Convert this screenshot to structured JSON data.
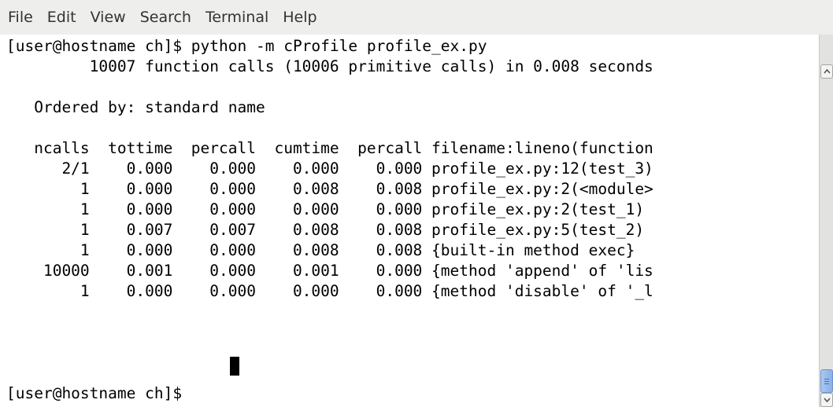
{
  "menu": {
    "items": [
      "File",
      "Edit",
      "View",
      "Search",
      "Terminal",
      "Help"
    ]
  },
  "terminal": {
    "prompt_command": "[user@hostname ch]$ python -m cProfile profile_ex.py",
    "summary": "         10007 function calls (10006 primitive calls) in 0.008 seconds",
    "ordered_by": "   Ordered by: standard name",
    "table_header": "   ncalls  tottime  percall  cumtime  percall filename:lineno(function",
    "rows": [
      "      2/1    0.000    0.000    0.000    0.000 profile_ex.py:12(test_3)",
      "        1    0.000    0.000    0.008    0.008 profile_ex.py:2(<module>",
      "        1    0.000    0.000    0.000    0.000 profile_ex.py:2(test_1)",
      "        1    0.007    0.007    0.008    0.008 profile_ex.py:5(test_2)",
      "        1    0.000    0.000    0.008    0.008 {built-in method exec}",
      "    10000    0.001    0.000    0.001    0.000 {method 'append' of 'lis",
      "        1    0.000    0.000    0.000    0.000 {method 'disable' of '_l"
    ],
    "final_prompt": "[user@hostname ch]$ "
  },
  "icons": {
    "scroll_up": "chevron-up-icon",
    "scroll_down": "chevron-down-icon"
  },
  "colors": {
    "menubar_bg": "#eeeeec",
    "terminal_bg": "#ffffff",
    "terminal_fg": "#000000",
    "scroll_thumb": "#8ab0e6"
  }
}
